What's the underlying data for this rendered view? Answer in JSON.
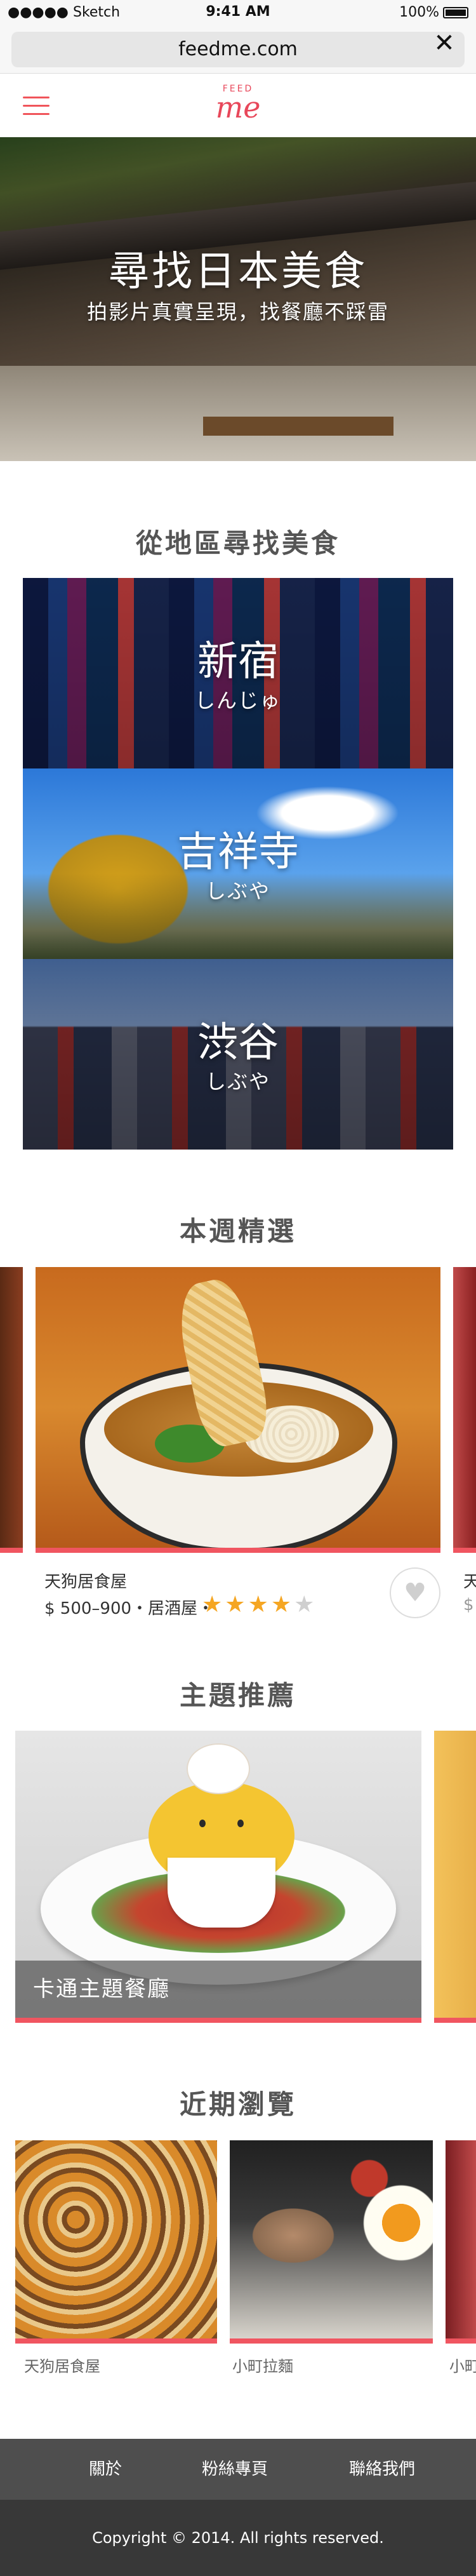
{
  "status_bar": {
    "carrier": "●●●●● Sketch",
    "time": "9:41 AM",
    "battery": "100%"
  },
  "browser": {
    "url": "feedme.com",
    "close_icon": "✕"
  },
  "header": {
    "logo_small": "FEED",
    "logo_big": "me"
  },
  "hero": {
    "title": "尋找日本美食",
    "subtitle": "拍影片真實呈現，找餐廳不踩雷"
  },
  "regions_section": {
    "title": "從地區尋找美食",
    "items": [
      {
        "name": "新宿",
        "kana": "しんじゅ"
      },
      {
        "name": "吉祥寺",
        "kana": "しぶや"
      },
      {
        "name": "渋谷",
        "kana": "しぶや"
      }
    ]
  },
  "weekly_section": {
    "title": "本週精選",
    "card": {
      "name": "天狗居食屋",
      "meta": "$ 500–900・居酒屋・",
      "rating": 4,
      "max_rating": 5
    },
    "peek_name": "天",
    "peek_meta": "$"
  },
  "theme_section": {
    "title": "主題推薦",
    "card_label": "卡通主題餐廳"
  },
  "recent_section": {
    "title": "近期瀏覽",
    "items": [
      {
        "name": "天狗居食屋"
      },
      {
        "name": "小町拉麵"
      },
      {
        "name": "小町"
      }
    ]
  },
  "footer": {
    "links": [
      "關於",
      "粉絲專頁",
      "聯絡我們"
    ],
    "copyright": "Copyright © 2014. All rights reserved."
  },
  "colors": {
    "accent": "#f05560",
    "footer_dark": "#383838",
    "footer_nav": "#4e4e4e",
    "star": "#f5a623"
  }
}
